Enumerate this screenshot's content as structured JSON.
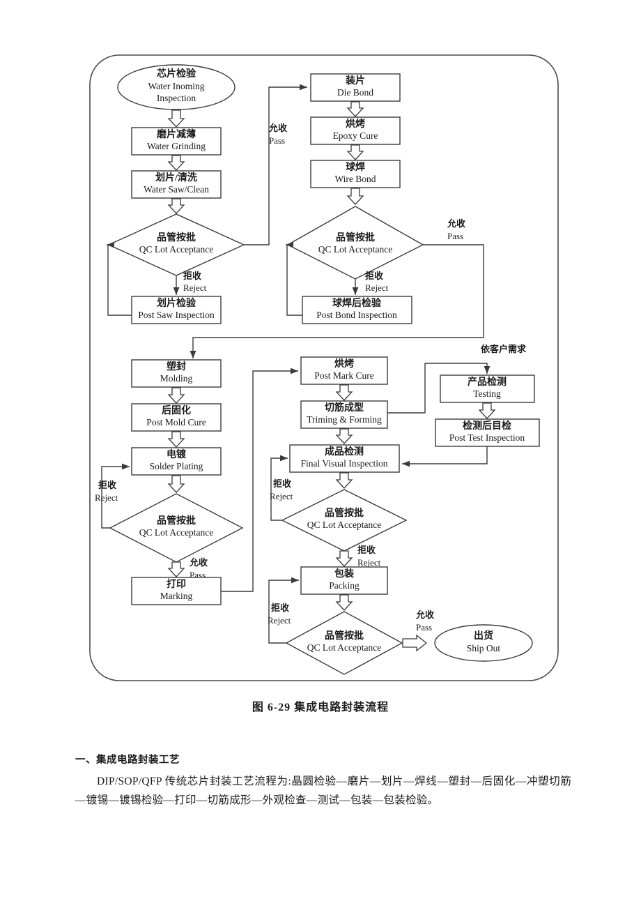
{
  "figure": {
    "caption": "图 6-29   集成电路封装流程",
    "nodes": {
      "wafer_incoming": {
        "cn": "芯片检验",
        "en1": "Water Inoming",
        "en2": "Inspection"
      },
      "wafer_grinding": {
        "cn": "磨片减薄",
        "en1": "Water Grinding"
      },
      "wafer_saw": {
        "cn": "划片/清洗",
        "en1": "Water Saw/Clean"
      },
      "qc1": {
        "cn": "品管按批",
        "en1": "QC Lot Acceptance"
      },
      "post_saw": {
        "cn": "划片检验",
        "en1": "Post Saw Inspection"
      },
      "die_bond": {
        "cn": "装片",
        "en1": "Die  Bond"
      },
      "epoxy_cure": {
        "cn": "烘烤",
        "en1": "Epoxy  Cure"
      },
      "wire_bond": {
        "cn": "球焊",
        "en1": "Wire  Bond"
      },
      "qc2": {
        "cn": "品管按批",
        "en1": "QC Lot Acceptance"
      },
      "post_bond": {
        "cn": "球焊后检验",
        "en1": "Post Bond Inspection"
      },
      "molding": {
        "cn": "塑封",
        "en1": "Molding"
      },
      "post_mold_cure": {
        "cn": "后固化",
        "en1": "Post Mold Cure"
      },
      "solder_plating": {
        "cn": "电镀",
        "en1": "Solder Plating"
      },
      "qc3": {
        "cn": "品管按批",
        "en1": "QC Lot Acceptance"
      },
      "marking": {
        "cn": "打印",
        "en1": "Marking"
      },
      "post_mark_cure": {
        "cn": "烘烤",
        "en1": "Post Mark Cure"
      },
      "triming_forming": {
        "cn": "切筋成型",
        "en1": "Triming & Forming"
      },
      "final_visual": {
        "cn": "成品检测",
        "en1": "Final Visual Inspection"
      },
      "qc4": {
        "cn": "品管按批",
        "en1": "QC Lot Acceptance"
      },
      "packing": {
        "cn": "包装",
        "en1": "Packing"
      },
      "qc5": {
        "cn": "品管按批",
        "en1": "QC Lot Acceptance"
      },
      "testing": {
        "cn": "产品检测",
        "en1": "Testing"
      },
      "post_test": {
        "cn": "检测后目检",
        "en1": "Post Test Inspection"
      },
      "ship_out": {
        "cn": "出货",
        "en1": "Ship Out"
      }
    },
    "edge_labels": {
      "pass1_cn": "允收",
      "pass1_en": "Pass",
      "reject1_cn": "拒收",
      "reject1_en": "Reject",
      "pass2_cn": "允收",
      "pass2_en": "Pass",
      "reject2_cn": "拒收",
      "reject2_en": "Reject",
      "reject3_cn": "拒收",
      "reject3_en": "Reject",
      "pass3_cn": "允收",
      "pass3_en": "Pass",
      "reject4_cn": "拒收",
      "reject4_en": "Reject",
      "reject5_cn": "拒收",
      "reject5_en": "Reject",
      "reject6_cn": "拒收",
      "reject6_en": "Reject",
      "pass5_cn": "允收",
      "pass5_en": "Pass",
      "customer_cn": "依客户需求"
    }
  },
  "body": {
    "heading": "一、集成电路封装工艺",
    "paragraph": "DIP/SOP/QFP 传统芯片封装工艺流程为:晶圆检验—磨片—划片—焊线—塑封—后固化—冲塑切筋—镀锡—镀锡检验—打印—切筋成形—外观检查—测试—包装—包装检验。"
  }
}
